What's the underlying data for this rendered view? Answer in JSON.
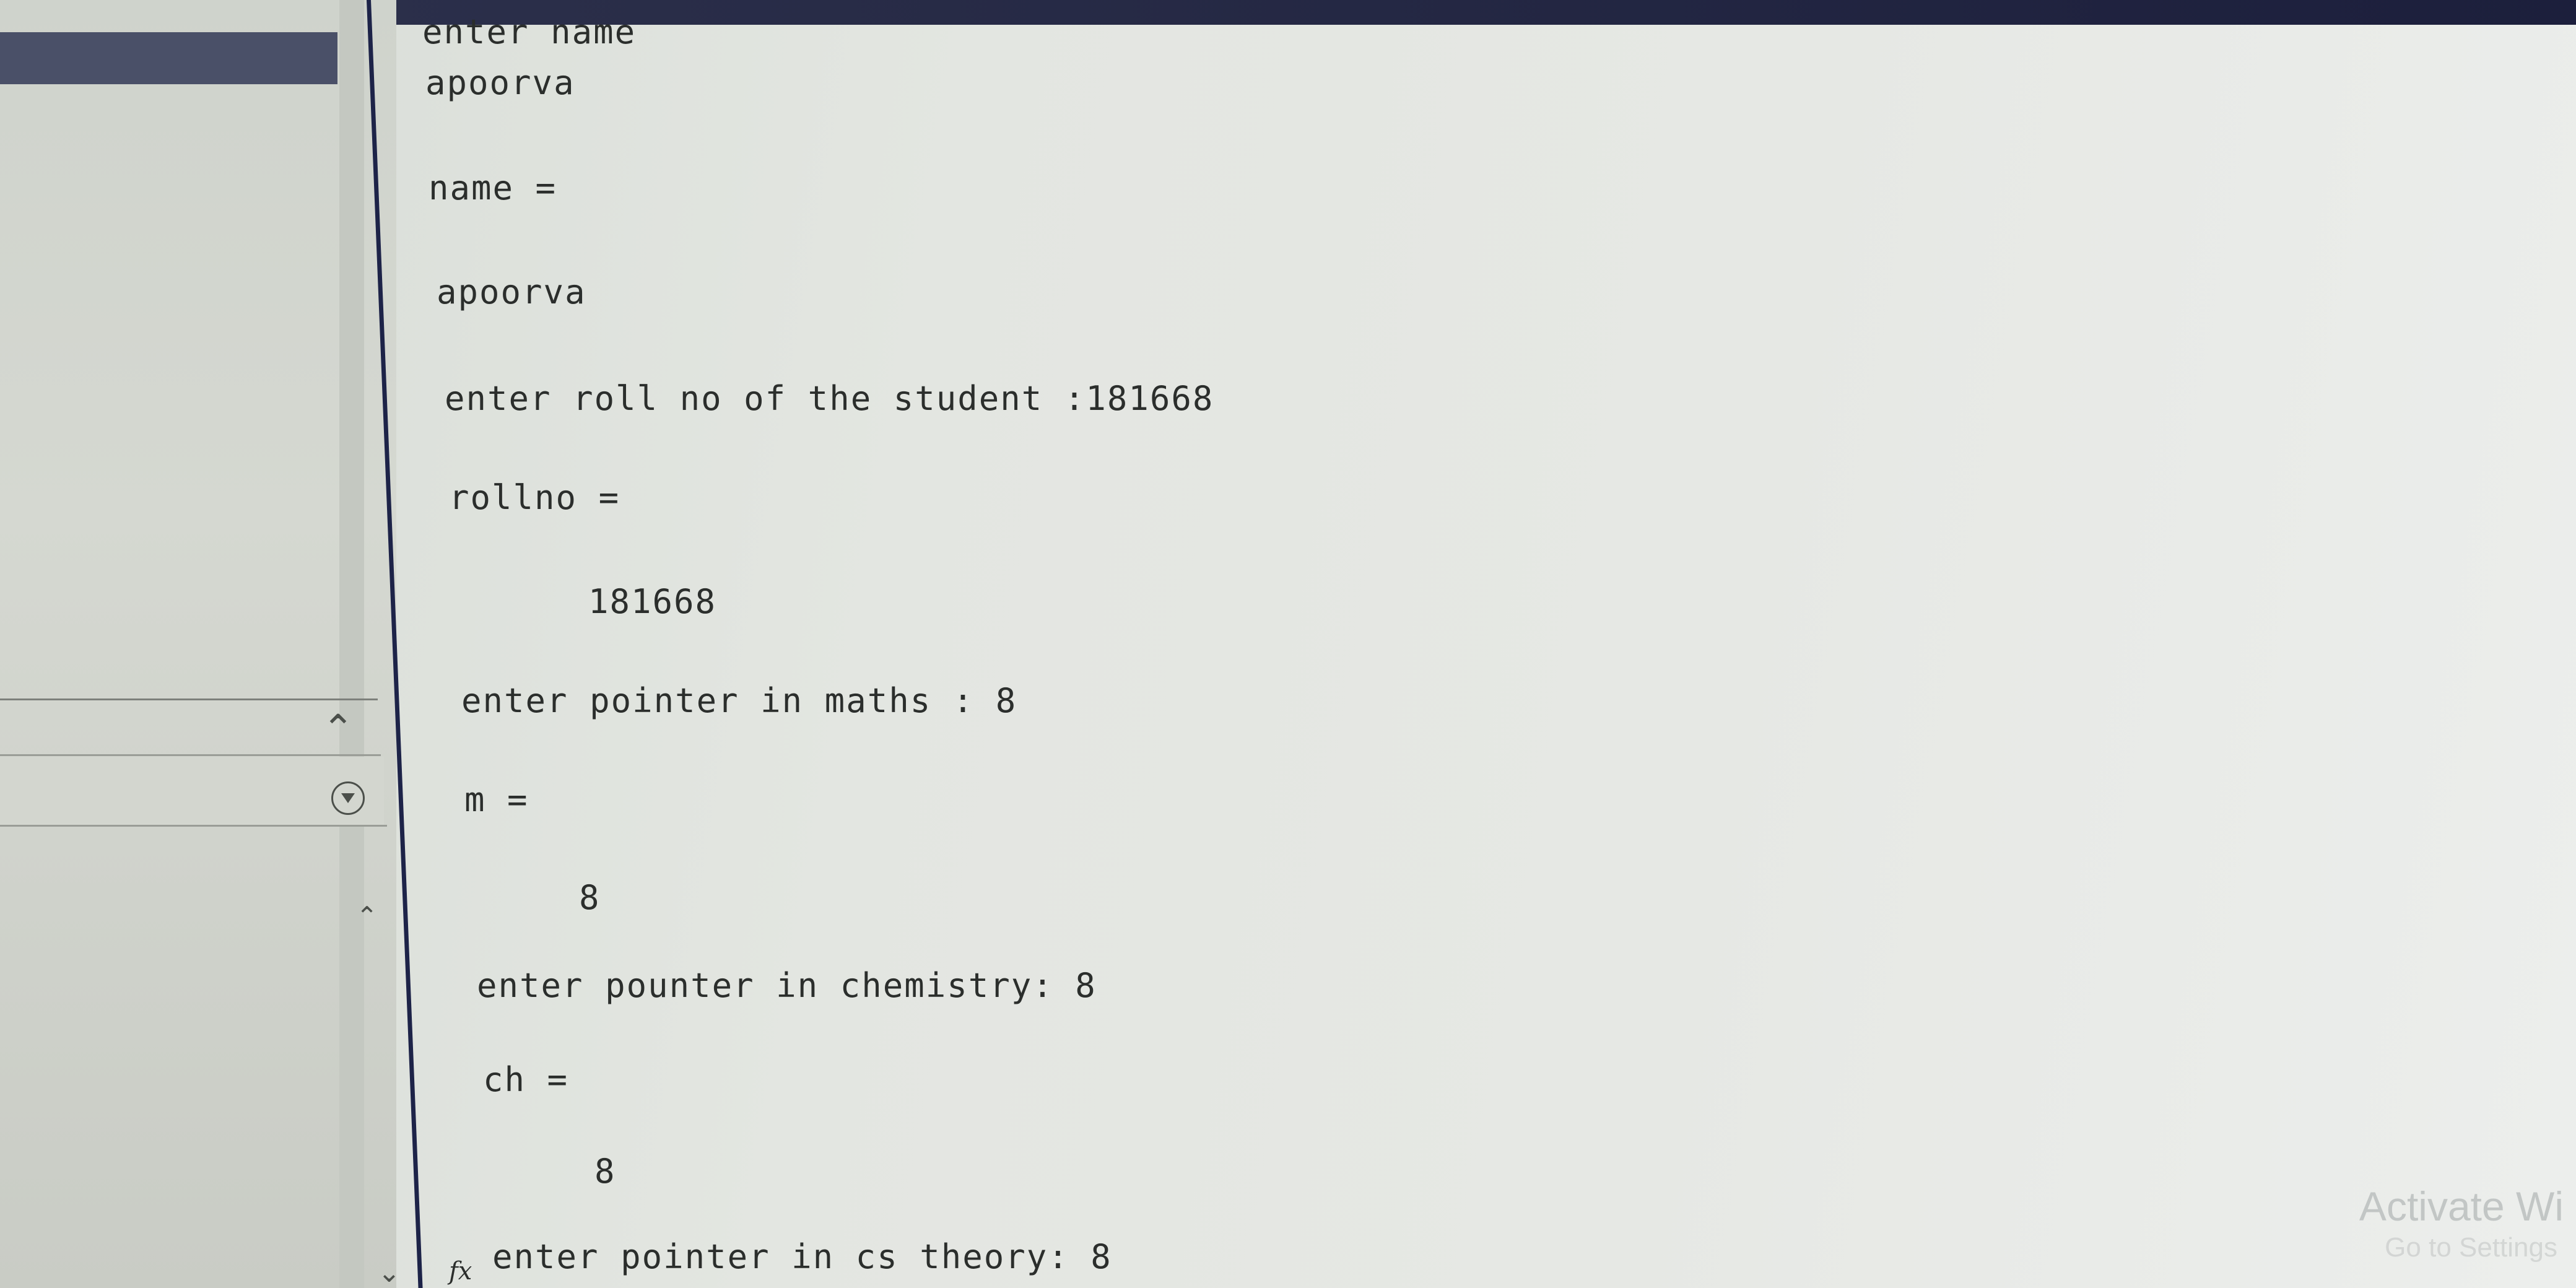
{
  "console": {
    "lines": [
      "enter name",
      "apoorva",
      "name =",
      "apoorva",
      "enter roll no of the student :181668",
      "rollno =",
      "181668",
      "enter pointer in maths : 8",
      "m =",
      "8",
      "enter pounter in chemistry: 8",
      "ch =",
      "8",
      "enter pointer in cs theory: 8"
    ]
  },
  "formula_bar": {
    "fx_label": "fx"
  },
  "watermark": {
    "title": "Activate Wi",
    "subtitle": "Go to Settings"
  },
  "icons": {
    "panel_collapse": "chevron-up-icon",
    "panel_menu": "circle-down-arrow-icon",
    "scroll_down": "chevron-down-icon"
  },
  "colors": {
    "top_bar": "#1c1f3c",
    "selected_item": "#4a5068",
    "console_text": "#2b2e2c"
  }
}
